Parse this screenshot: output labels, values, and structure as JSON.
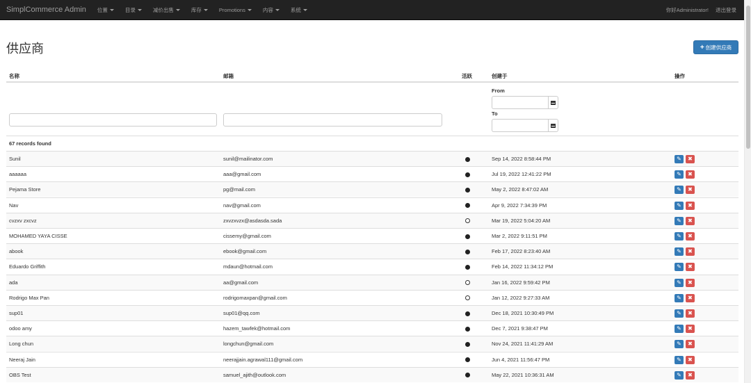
{
  "navbar": {
    "brand": "SimplCommerce Admin",
    "menu": [
      {
        "label": "位置"
      },
      {
        "label": "目录"
      },
      {
        "label": "减价出售"
      },
      {
        "label": "库存"
      },
      {
        "label": "Promotions"
      },
      {
        "label": "内容"
      },
      {
        "label": "系统"
      }
    ],
    "greeting": "你好Administrator!",
    "logout": "退出登录"
  },
  "page": {
    "title": "供应商",
    "create_button": "创建供应商",
    "records_found": "67 records found"
  },
  "table": {
    "headers": {
      "name": "名称",
      "email": "邮箱",
      "active": "活跃",
      "created": "创建于",
      "actions": "操作"
    },
    "filter": {
      "from_label": "From",
      "to_label": "To"
    },
    "rows": [
      {
        "name": "Sunil",
        "email": "sunil@mailinator.com",
        "active": true,
        "created": "Sep 14, 2022 8:58:44 PM"
      },
      {
        "name": "aaaaaa",
        "email": "aaa@gmail.com",
        "active": true,
        "created": "Jul 19, 2022 12:41:22 PM"
      },
      {
        "name": "Pejama Store",
        "email": "pg@mail.com",
        "active": true,
        "created": "May 2, 2022 8:47:02 AM"
      },
      {
        "name": "Nav",
        "email": "nav@gmail.com",
        "active": true,
        "created": "Apr 9, 2022 7:34:39 PM"
      },
      {
        "name": "cvzxv zxcvz",
        "email": "zxvzxvzx@asdasda.sada",
        "active": false,
        "created": "Mar 19, 2022 5:04:20 AM"
      },
      {
        "name": "MOHAMED YAYA CISSE",
        "email": "cissemy@gmail.com",
        "active": true,
        "created": "Mar 2, 2022 9:11:51 PM"
      },
      {
        "name": "abook",
        "email": "ebook@gmail.com",
        "active": true,
        "created": "Feb 17, 2022 8:23:40 AM"
      },
      {
        "name": "Eduardo Griffith",
        "email": "mdaun@hotmail.com",
        "active": true,
        "created": "Feb 14, 2022 11:34:12 PM"
      },
      {
        "name": "ada",
        "email": "aa@gmail.com",
        "active": false,
        "created": "Jan 16, 2022 9:59:42 PM"
      },
      {
        "name": "Rodrigo Max Pan",
        "email": "rodrigomaxpan@gmail.com",
        "active": false,
        "created": "Jan 12, 2022 9:27:33 AM"
      },
      {
        "name": "sup01",
        "email": "sup01@qq.com",
        "active": true,
        "created": "Dec 18, 2021 10:30:49 PM"
      },
      {
        "name": "odoo amy",
        "email": "hazem_tawfek@hotmail.com",
        "active": true,
        "created": "Dec 7, 2021 9:38:47 PM"
      },
      {
        "name": "Long chun",
        "email": "longchun@gmail.com",
        "active": true,
        "created": "Nov 24, 2021 11:41:29 AM"
      },
      {
        "name": "Neeraj Jain",
        "email": "neerajjain.agrawal111@gmail.com",
        "active": true,
        "created": "Jun 4, 2021 11:56:47 PM"
      },
      {
        "name": "OBS Test",
        "email": "samuel_ajith@outlook.com",
        "active": true,
        "created": "May 22, 2021 10:36:31 AM"
      }
    ]
  }
}
